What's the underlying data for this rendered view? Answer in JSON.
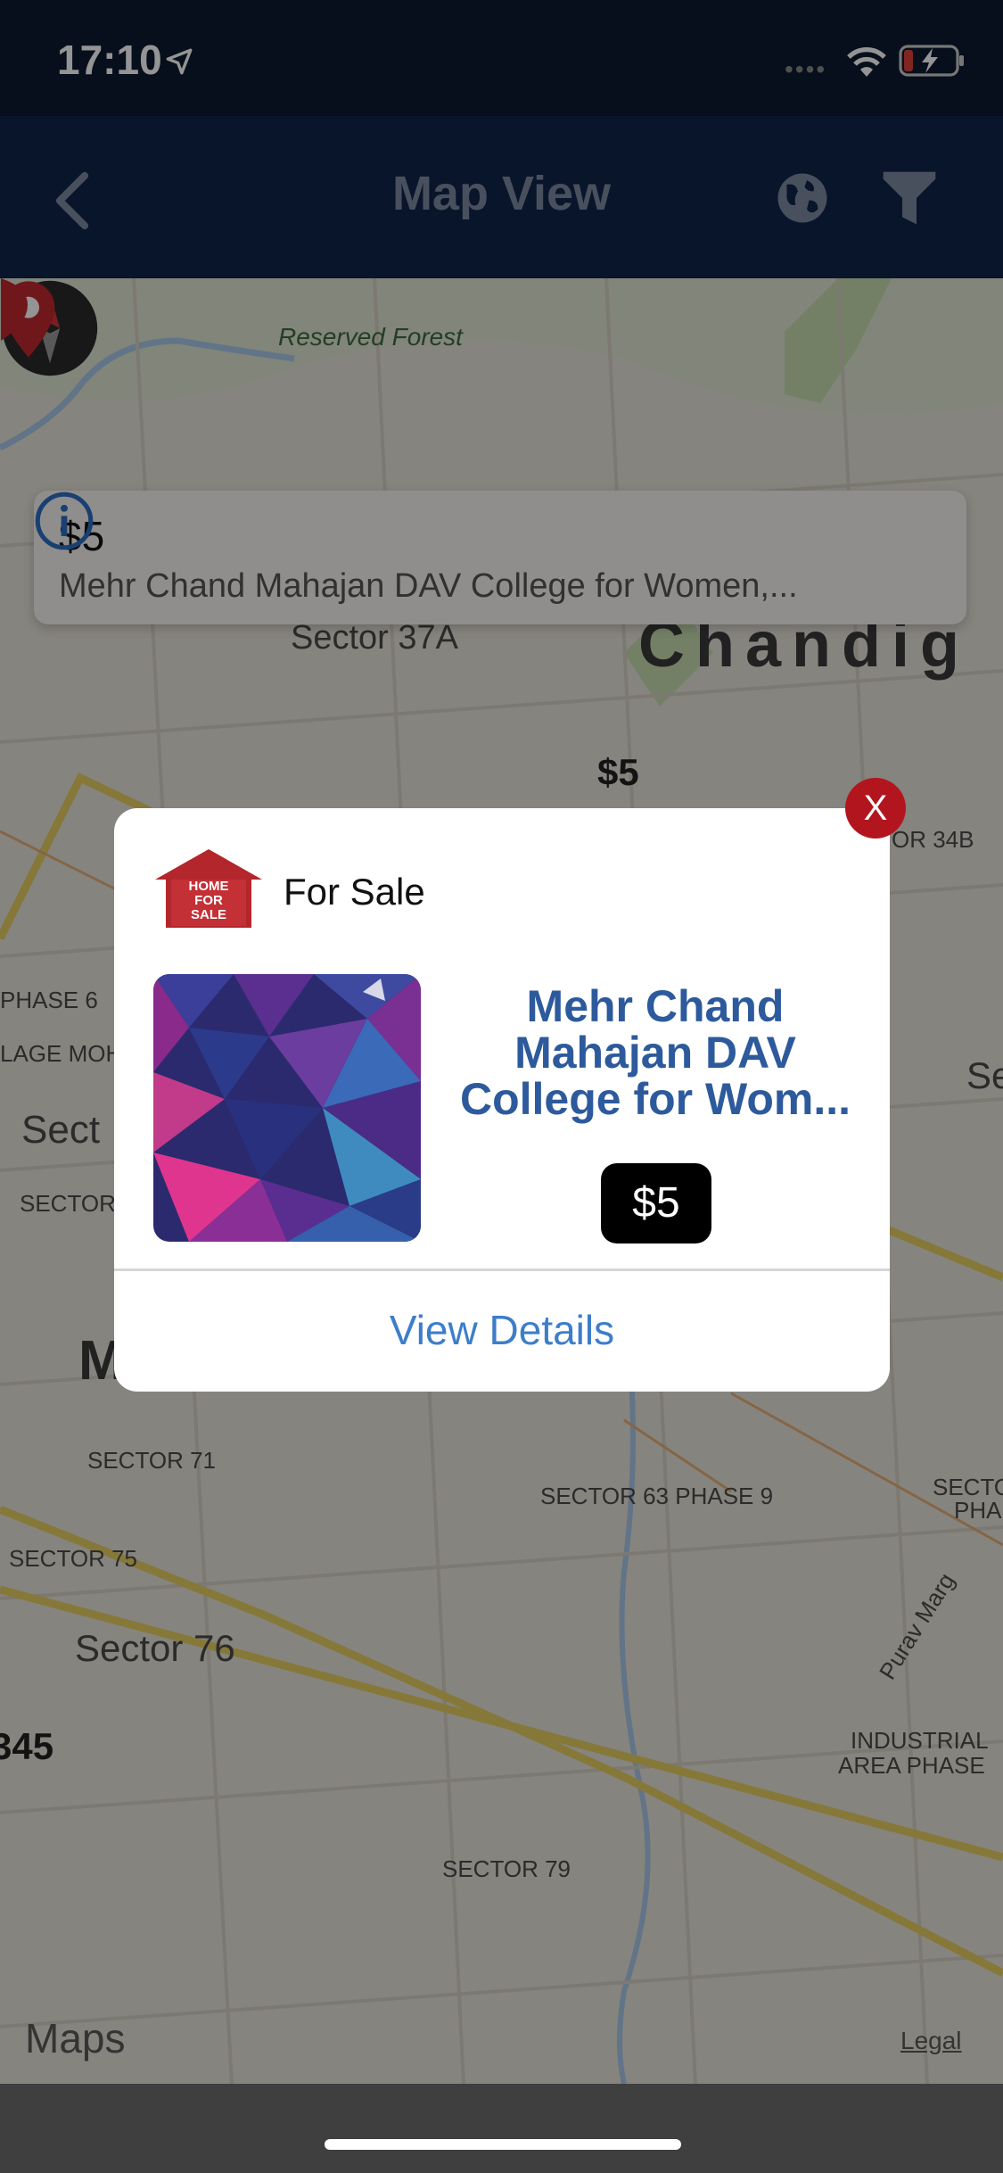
{
  "status_bar": {
    "time": "17:10"
  },
  "nav": {
    "title": "Map View"
  },
  "map": {
    "labels": [
      "Reserved Forest",
      "Sector 37A",
      "Chandig",
      "PHASE 6",
      "LAGE MOH",
      "Sect",
      "SECTOR",
      "SECTOR 71",
      "M",
      "SECTOR 63 PHASE 9",
      "SECTOR 75",
      "Sector 76",
      "SECTO",
      "PHA",
      "Purav Marg",
      "INDUSTRIAL",
      "AREA PHASE",
      "SECTOR 79",
      "OR 34B",
      "Se"
    ],
    "callout": {
      "price": "$5",
      "address": "Mehr Chand Mahajan DAV College for Women,..."
    },
    "pin_price": "$5",
    "edge_pin_price": "345",
    "maps_logo": "Maps",
    "legal": "Legal"
  },
  "popup": {
    "type": "For Sale",
    "sale_icon_text": [
      "HOME",
      "FOR",
      "SALE"
    ],
    "title": "Mehr Chand Mahajan DAV College for Wom...",
    "price": "$5",
    "view_details": "View Details",
    "close": "X"
  },
  "colors": {
    "status_bg": "#0c1a30",
    "nav_bg": "#10254a",
    "title_blue": "#2d5a9c",
    "link_blue": "#3d7ec9",
    "close_red": "#b3151f"
  }
}
